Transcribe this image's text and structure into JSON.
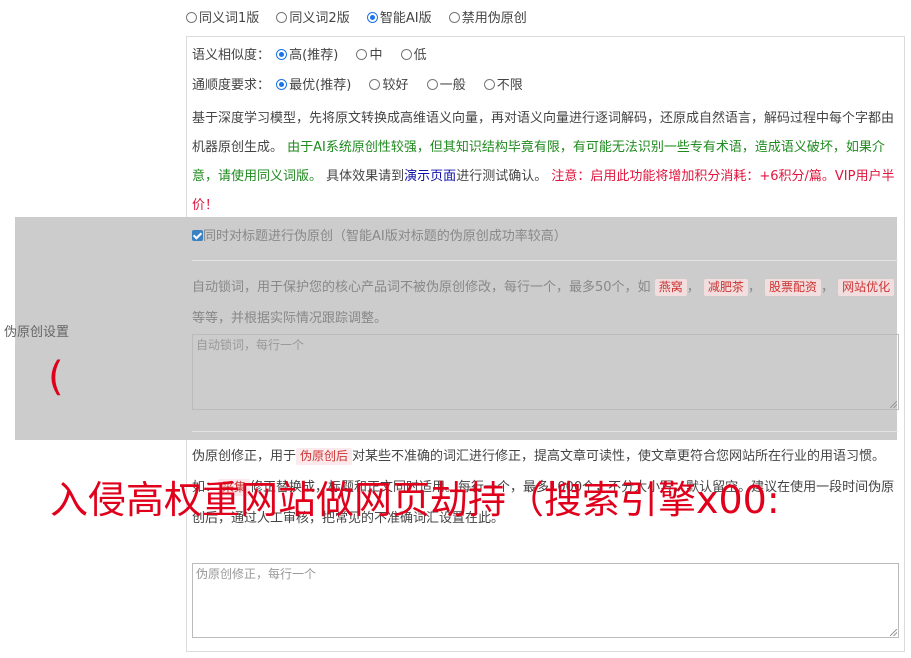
{
  "version_options": [
    {
      "label": "同义词1版",
      "selected": false
    },
    {
      "label": "同义词2版",
      "selected": false
    },
    {
      "label": "智能AI版",
      "selected": true
    },
    {
      "label": "禁用伪原创",
      "selected": false
    }
  ],
  "similarity": {
    "label": "语义相似度：",
    "options": [
      {
        "label": "高(推荐)",
        "selected": true
      },
      {
        "label": "中",
        "selected": false
      },
      {
        "label": "低",
        "selected": false
      }
    ]
  },
  "fluency": {
    "label": "通顺度要求：",
    "options": [
      {
        "label": "最优(推荐)",
        "selected": true
      },
      {
        "label": "较好",
        "selected": false
      },
      {
        "label": "一般",
        "selected": false
      },
      {
        "label": "不限",
        "selected": false
      }
    ]
  },
  "description": {
    "intro": "基于深度学习模型，先将原文转换成高维语义向量，再对语义向量进行逐词解码，还原成自然语言，解码过程中每个字都由机器原创生成。",
    "warning_green": "由于AI系统原创性较强，但其知识结构毕竟有限，有可能无法识别一些专有术语，造成语义破坏，如果介意，请使用同义词版。",
    "test_prefix": "具体效果请到",
    "test_link": "演示页面",
    "test_suffix": "进行测试确认。",
    "note_red": "注意：启用此功能将增加积分消耗：+6积分/篇。VIP用户半价！"
  },
  "title_checkbox": {
    "checked": true,
    "label": "同时对标题进行伪原创（智能AI版对标题的伪原创成功率较高）"
  },
  "lock_words": {
    "desc_prefix": "自动锁词，用于保护您的核心产品词不被伪原创修改，每行一个，最多50个，如",
    "examples": [
      "燕窝",
      "减肥茶",
      "股票配资",
      "网站优化"
    ],
    "desc_suffix": "等等，并根据实际情况跟踪调整。",
    "placeholder": "自动锁词，每行一个"
  },
  "side_label": "伪原创设置",
  "paren": "(",
  "correction": {
    "prefix": "伪原创修正，用于",
    "tag1": "伪原创后",
    "text1": "对某些不准确的词汇进行修正，提高文章可读性，使文章更符合您网站所在行业的用语习惯。如：",
    "tag2": "采集",
    "text2": "修正替换成",
    "text3": "，标题和正文同时适用。每行一个，最多1000个，不分大小写，默认留空。建议在使用一段时间伪原创后，通过人工审核，把常见的不准确词汇设置在此。",
    "placeholder": "伪原创修正，每行一个"
  },
  "watermark": "入侵高权重网站做网页劫持（搜索引擎x00:",
  "colors": {
    "accent": "#1a73e8",
    "green": "#1f8a1f",
    "red": "#e0143c",
    "link": "#1111aa",
    "overlay": "#cccccc"
  }
}
